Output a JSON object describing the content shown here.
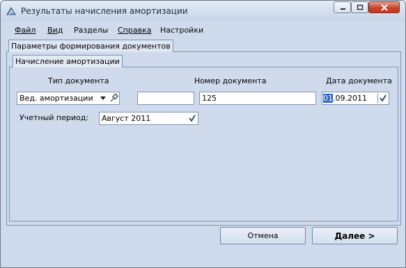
{
  "window": {
    "title": "Результаты начисления амортизации"
  },
  "menu": [
    {
      "label": "Файл"
    },
    {
      "label": "Вид"
    },
    {
      "label": "Разделы"
    },
    {
      "label": "Справка"
    },
    {
      "label": "Настройки"
    }
  ],
  "tabs": {
    "outer": "Параметры формирования документов",
    "inner": "Начисление амортизации"
  },
  "form": {
    "doc_type_label": "Тип документа",
    "doc_number_label": "Номер документа",
    "doc_date_label": "Дата документа",
    "doc_type_value": "Вед. амортизации",
    "doc_number_value": "125",
    "doc_date_selected": "01",
    "doc_date_rest": ".09.2011",
    "period_label": "Учетный период:",
    "period_value": "Август 2011"
  },
  "buttons": {
    "cancel": "Отмена",
    "next": "Далее >"
  }
}
